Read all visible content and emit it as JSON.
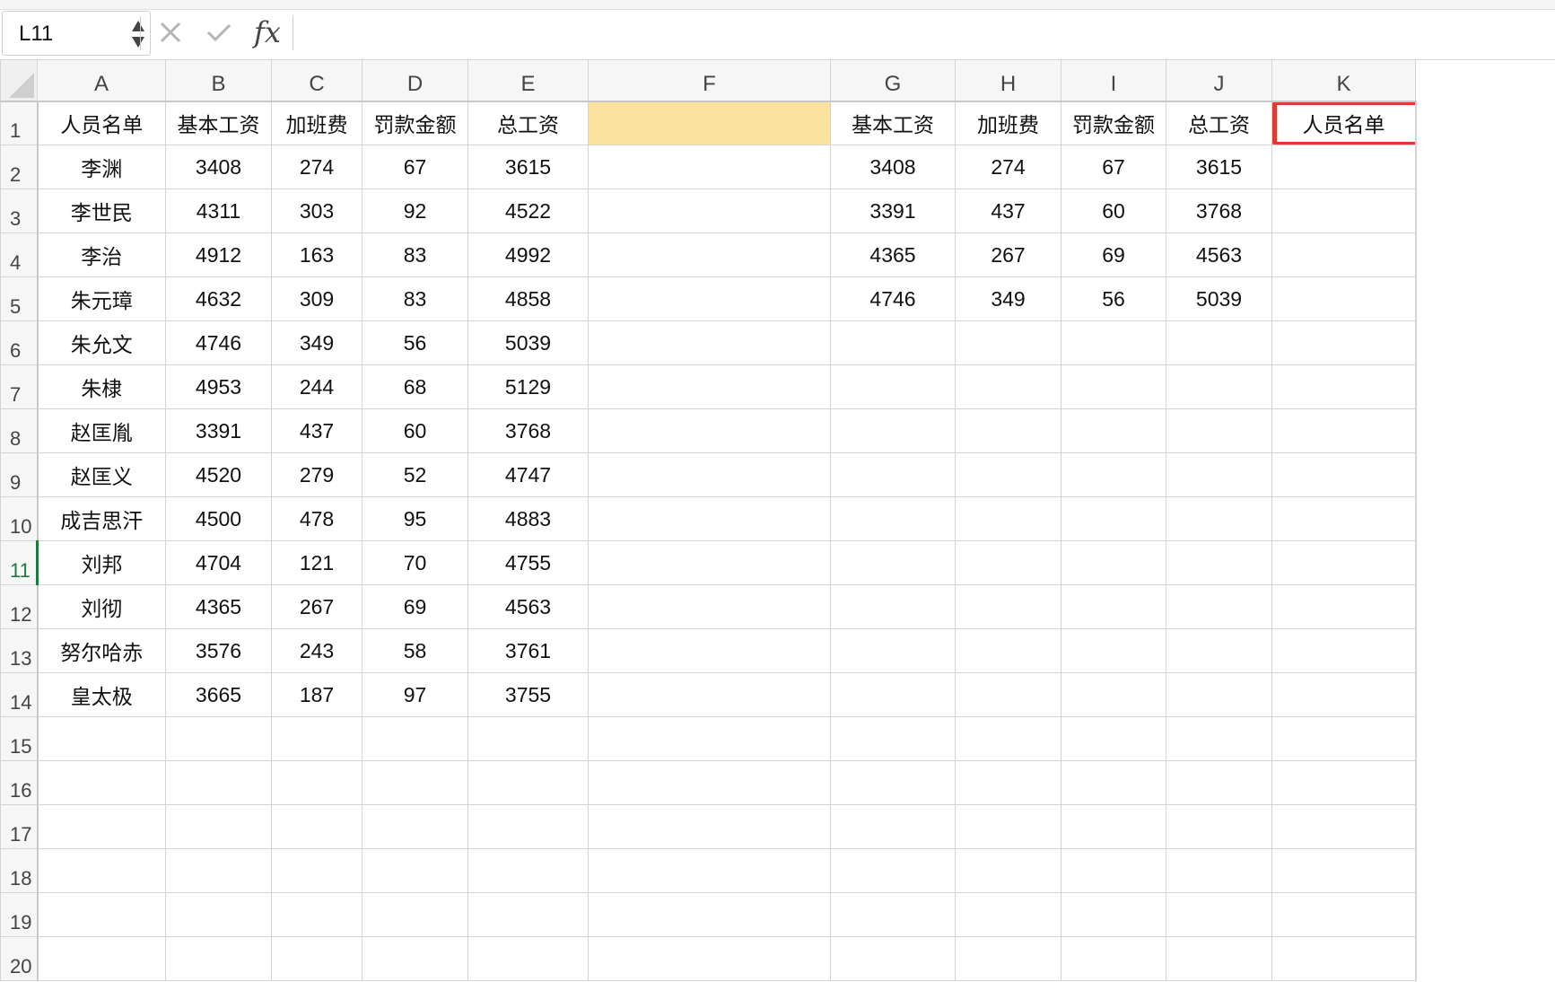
{
  "formula_bar": {
    "cell_ref": "L11",
    "fx_label": "fx",
    "formula": ""
  },
  "columns": [
    "A",
    "B",
    "C",
    "D",
    "E",
    "F",
    "G",
    "H",
    "I",
    "J",
    "K"
  ],
  "rows": [
    {
      "n": "1",
      "cells": [
        "人员名单",
        "基本工资",
        "加班费",
        "罚款金额",
        "总工资",
        "",
        "基本工资",
        "加班费",
        "罚款金额",
        "总工资",
        "人员名单"
      ]
    },
    {
      "n": "2",
      "cells": [
        "李渊",
        "3408",
        "274",
        "67",
        "3615",
        "",
        "3408",
        "274",
        "67",
        "3615",
        ""
      ]
    },
    {
      "n": "3",
      "cells": [
        "李世民",
        "4311",
        "303",
        "92",
        "4522",
        "",
        "3391",
        "437",
        "60",
        "3768",
        ""
      ]
    },
    {
      "n": "4",
      "cells": [
        "李治",
        "4912",
        "163",
        "83",
        "4992",
        "",
        "4365",
        "267",
        "69",
        "4563",
        ""
      ]
    },
    {
      "n": "5",
      "cells": [
        "朱元璋",
        "4632",
        "309",
        "83",
        "4858",
        "",
        "4746",
        "349",
        "56",
        "5039",
        ""
      ]
    },
    {
      "n": "6",
      "cells": [
        "朱允文",
        "4746",
        "349",
        "56",
        "5039",
        "",
        "",
        "",
        "",
        "",
        ""
      ]
    },
    {
      "n": "7",
      "cells": [
        "朱棣",
        "4953",
        "244",
        "68",
        "5129",
        "",
        "",
        "",
        "",
        "",
        ""
      ]
    },
    {
      "n": "8",
      "cells": [
        "赵匡胤",
        "3391",
        "437",
        "60",
        "3768",
        "",
        "",
        "",
        "",
        "",
        ""
      ]
    },
    {
      "n": "9",
      "cells": [
        "赵匡义",
        "4520",
        "279",
        "52",
        "4747",
        "",
        "",
        "",
        "",
        "",
        ""
      ]
    },
    {
      "n": "10",
      "cells": [
        "成吉思汗",
        "4500",
        "478",
        "95",
        "4883",
        "",
        "",
        "",
        "",
        "",
        ""
      ]
    },
    {
      "n": "11",
      "cells": [
        "刘邦",
        "4704",
        "121",
        "70",
        "4755",
        "",
        "",
        "",
        "",
        "",
        ""
      ]
    },
    {
      "n": "12",
      "cells": [
        "刘彻",
        "4365",
        "267",
        "69",
        "4563",
        "",
        "",
        "",
        "",
        "",
        ""
      ]
    },
    {
      "n": "13",
      "cells": [
        "努尔哈赤",
        "3576",
        "243",
        "58",
        "3761",
        "",
        "",
        "",
        "",
        "",
        ""
      ]
    },
    {
      "n": "14",
      "cells": [
        "皇太极",
        "3665",
        "187",
        "97",
        "3755",
        "",
        "",
        "",
        "",
        "",
        ""
      ]
    },
    {
      "n": "15",
      "cells": [
        "",
        "",
        "",
        "",
        "",
        "",
        "",
        "",
        "",
        "",
        ""
      ]
    },
    {
      "n": "16",
      "cells": [
        "",
        "",
        "",
        "",
        "",
        "",
        "",
        "",
        "",
        "",
        ""
      ]
    },
    {
      "n": "17",
      "cells": [
        "",
        "",
        "",
        "",
        "",
        "",
        "",
        "",
        "",
        "",
        ""
      ]
    },
    {
      "n": "18",
      "cells": [
        "",
        "",
        "",
        "",
        "",
        "",
        "",
        "",
        "",
        "",
        ""
      ]
    },
    {
      "n": "19",
      "cells": [
        "",
        "",
        "",
        "",
        "",
        "",
        "",
        "",
        "",
        "",
        ""
      ]
    },
    {
      "n": "20",
      "cells": [
        "",
        "",
        "",
        "",
        "",
        "",
        "",
        "",
        "",
        "",
        ""
      ]
    }
  ],
  "active_row": "11",
  "highlight_color": "#fce29f",
  "annotation_color": "#e03b30",
  "accent_color": "#1d7a3d"
}
